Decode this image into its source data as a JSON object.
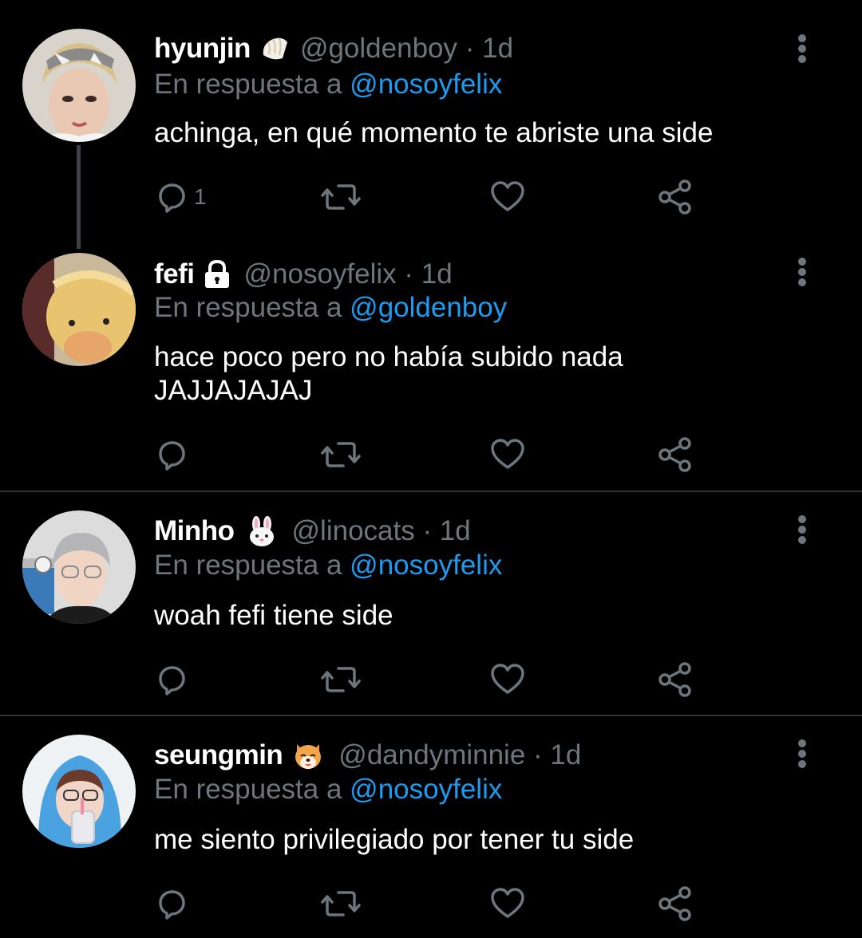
{
  "tweets": [
    {
      "name": "hyunjin",
      "emoji": "dumpling-emoji",
      "handle": "@goldenboy · 1d",
      "reply_prefix": "En respuesta a",
      "reply_to": "@nosoyfelix",
      "text": "achinga, en qué momento te abriste una side",
      "reply_count": "1"
    },
    {
      "name": "fefi",
      "emoji": "lock-icon",
      "handle": "@nosoyfelix · 1d",
      "reply_prefix": "En respuesta a",
      "reply_to": "@goldenboy",
      "text_lines": [
        "hace poco pero no había subido nada",
        "JAJJAJAJAJ"
      ],
      "reply_count": ""
    },
    {
      "name": "Minho",
      "emoji": "rabbit-emoji",
      "handle": "@linocats · 1d",
      "reply_prefix": "En respuesta a",
      "reply_to": "@nosoyfelix",
      "text": "woah fefi tiene side",
      "reply_count": ""
    },
    {
      "name": "seungmin",
      "emoji": "dog-emoji",
      "handle": "@dandyminnie · 1d",
      "reply_prefix": "En respuesta a",
      "reply_to": "@nosoyfelix",
      "text": "me siento privilegiado por tener tu side",
      "reply_count": ""
    }
  ],
  "colors": {
    "background": "#000000",
    "text": "#ffffff",
    "secondary": "#6e767d",
    "link": "#1d9bf0",
    "divider": "#2f3336",
    "thread_line": "#3d4148"
  }
}
